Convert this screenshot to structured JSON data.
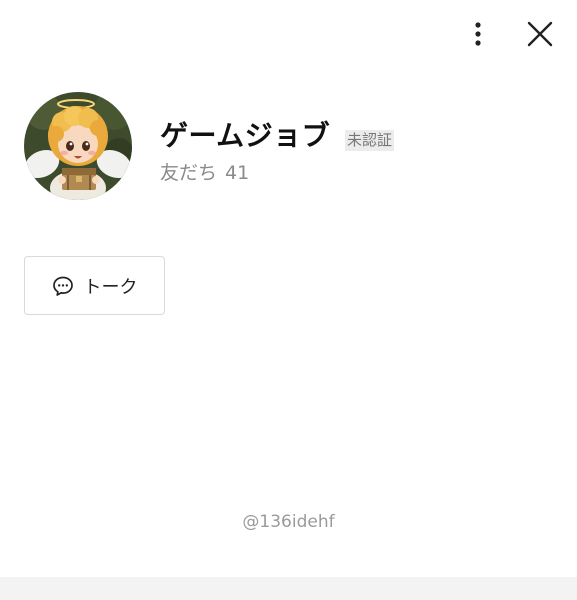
{
  "header": {
    "more_icon": "vertical-ellipsis-icon",
    "close_icon": "close-icon"
  },
  "profile": {
    "name": "ゲームジョブ",
    "badge": "未認証",
    "friends_label": "友だち",
    "friends_count": "41",
    "avatar_icon": "angel-character-avatar"
  },
  "actions": {
    "talk_label": "トーク",
    "talk_icon": "chat-bubble-icon"
  },
  "footer": {
    "user_id": "@136idehf"
  }
}
